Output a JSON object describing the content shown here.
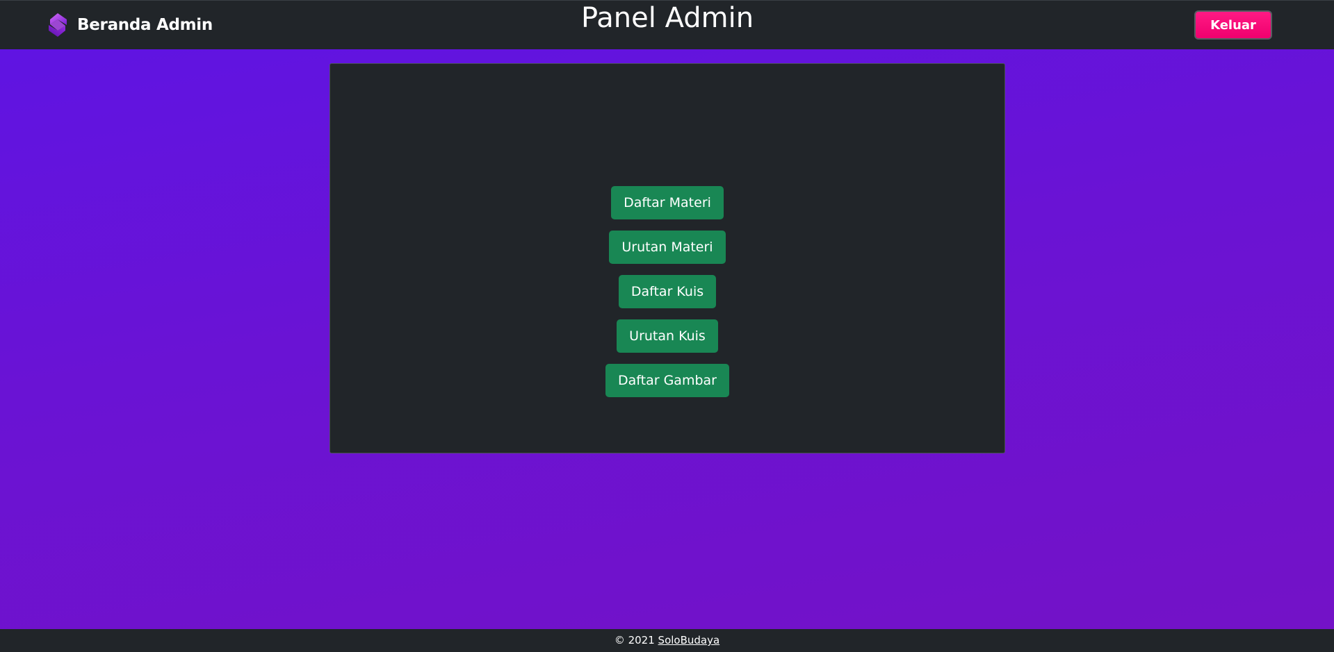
{
  "navbar": {
    "brand_label": "Beranda Admin",
    "logout_label": "Keluar"
  },
  "panel": {
    "title": "Panel Admin",
    "buttons": [
      {
        "label": "Daftar Materi"
      },
      {
        "label": "Urutan Materi"
      },
      {
        "label": "Daftar Kuis"
      },
      {
        "label": "Urutan Kuis"
      },
      {
        "label": "Daftar Gambar"
      }
    ]
  },
  "footer": {
    "copyright": "© 2021",
    "link_label": "SoloBudaya"
  },
  "colors": {
    "background_top": "#5e14e4",
    "background_bottom": "#7412c6",
    "navbar": "#212529",
    "logout_button": "#f0006e",
    "action_button": "#198754"
  },
  "icons": {
    "brand": "logo-icon"
  }
}
